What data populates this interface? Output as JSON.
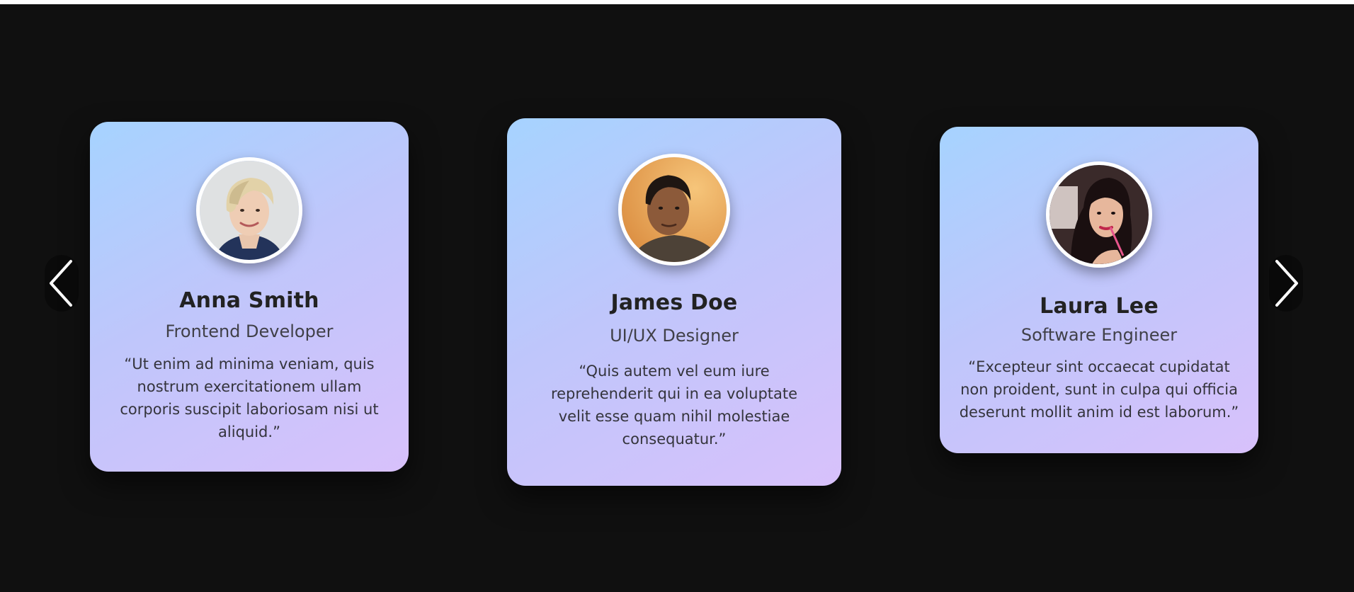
{
  "navigation": {
    "prev_icon": "chevron-left-icon",
    "next_icon": "chevron-right-icon"
  },
  "testimonials": [
    {
      "name": "Anna Smith",
      "role": "Frontend Developer",
      "quote": "“Ut enim ad minima veniam, quis nostrum exercitationem ullam corporis suscipit laboriosam nisi ut aliquid.”"
    },
    {
      "name": "James Doe",
      "role": "UI/UX Designer",
      "quote": "“Quis autem vel eum iure reprehenderit qui in ea voluptate velit esse quam nihil molestiae consequatur.”"
    },
    {
      "name": "Laura Lee",
      "role": "Software Engineer",
      "quote": "“Excepteur sint occaecat cupidatat non proident, sunt in culpa qui officia deserunt mollit anim id est laborum.”"
    }
  ],
  "colors": {
    "background": "#101010",
    "card_gradient_start": "#a6d3ff",
    "card_gradient_end": "#d8c1fb",
    "name_text": "#222222",
    "arrow": "#ffffff"
  }
}
